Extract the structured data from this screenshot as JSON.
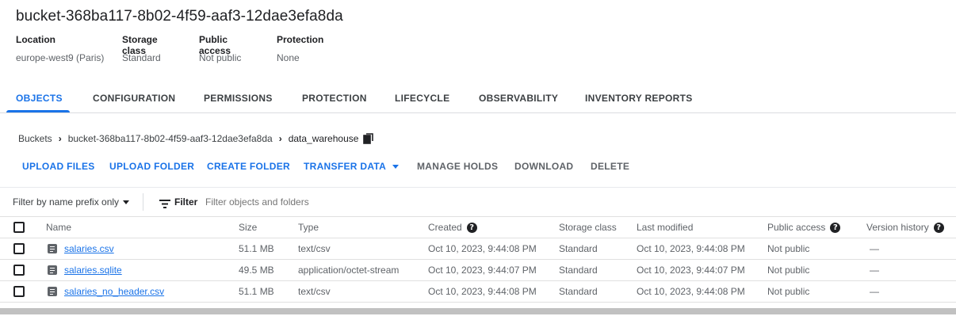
{
  "bucket": {
    "title": "bucket-368ba117-8b02-4f59-aaf3-12dae3efa8da",
    "meta": [
      {
        "label": "Location",
        "value": "europe-west9 (Paris)"
      },
      {
        "label": "Storage class",
        "value": "Standard"
      },
      {
        "label": "Public access",
        "value": "Not public"
      },
      {
        "label": "Protection",
        "value": "None"
      }
    ]
  },
  "tabs": [
    "OBJECTS",
    "CONFIGURATION",
    "PERMISSIONS",
    "PROTECTION",
    "LIFECYCLE",
    "OBSERVABILITY",
    "INVENTORY REPORTS"
  ],
  "active_tab": "OBJECTS",
  "breadcrumb": {
    "root": "Buckets",
    "bucket": "bucket-368ba117-8b02-4f59-aaf3-12dae3efa8da",
    "folder": "data_warehouse"
  },
  "actions": {
    "upload_files": "UPLOAD FILES",
    "upload_folder": "UPLOAD FOLDER",
    "create_folder": "CREATE FOLDER",
    "transfer_data": "TRANSFER DATA",
    "manage_holds": "MANAGE HOLDS",
    "download": "DOWNLOAD",
    "delete": "DELETE"
  },
  "filter": {
    "prefix_mode": "Filter by name prefix only",
    "label": "Filter",
    "placeholder": "Filter objects and folders"
  },
  "table": {
    "headers": {
      "name": "Name",
      "size": "Size",
      "type": "Type",
      "created": "Created",
      "storage_class": "Storage class",
      "last_modified": "Last modified",
      "public_access": "Public access",
      "version_history": "Version history"
    },
    "rows": [
      {
        "name": "salaries.csv",
        "size": "51.1 MB",
        "type": "text/csv",
        "created": "Oct 10, 2023, 9:44:08 PM",
        "storage_class": "Standard",
        "last_modified": "Oct 10, 2023, 9:44:08 PM",
        "public_access": "Not public",
        "version_history": "—"
      },
      {
        "name": "salaries.sqlite",
        "size": "49.5 MB",
        "type": "application/octet-stream",
        "created": "Oct 10, 2023, 9:44:07 PM",
        "storage_class": "Standard",
        "last_modified": "Oct 10, 2023, 9:44:07 PM",
        "public_access": "Not public",
        "version_history": "—"
      },
      {
        "name": "salaries_no_header.csv",
        "size": "51.1 MB",
        "type": "text/csv",
        "created": "Oct 10, 2023, 9:44:08 PM",
        "storage_class": "Standard",
        "last_modified": "Oct 10, 2023, 9:44:08 PM",
        "public_access": "Not public",
        "version_history": "—"
      }
    ]
  },
  "colors": {
    "accent": "#1a73e8",
    "text": "#202124",
    "muted": "#5f6368"
  }
}
